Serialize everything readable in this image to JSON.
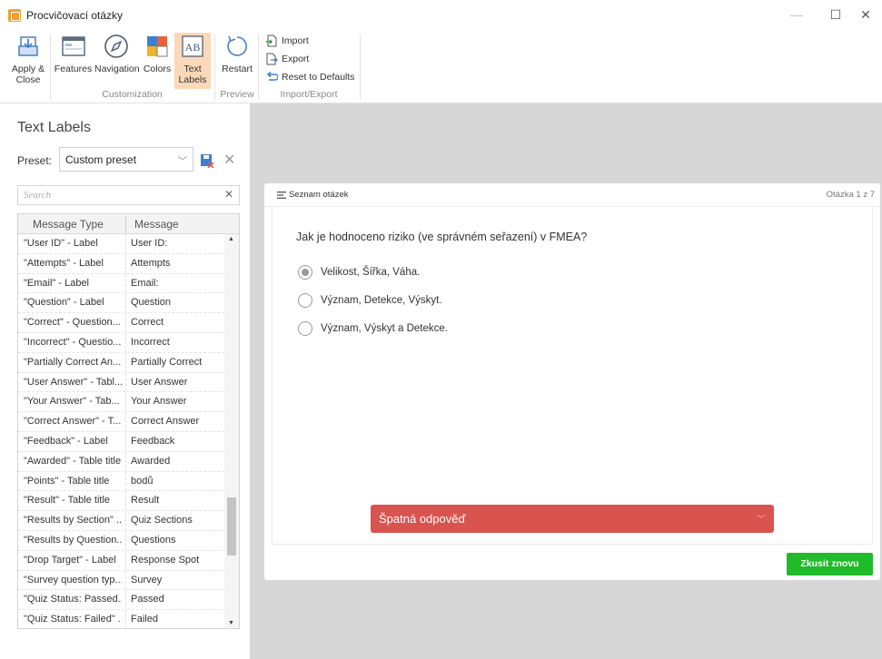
{
  "window": {
    "title": "Procvičovací otázky",
    "min": "—",
    "max": "☐",
    "close": "✕"
  },
  "ribbon": {
    "apply_close": "Apply & Close",
    "features": "Features",
    "navigation": "Navigation",
    "colors": "Colors",
    "text_labels": "Text Labels",
    "restart": "Restart",
    "import": "Import",
    "export": "Export",
    "reset": "Reset to Defaults",
    "groups": {
      "customization": "Customization",
      "preview": "Preview",
      "import_export": "Import/Export"
    }
  },
  "left": {
    "title": "Text Labels",
    "preset_label": "Preset:",
    "preset_value": "Custom preset",
    "search_placeholder": "Search",
    "columns": [
      "Message Type",
      "Message"
    ],
    "rows": [
      [
        "\"User ID\" - Label",
        "User ID:"
      ],
      [
        "\"Attempts\" - Label",
        "Attempts"
      ],
      [
        "\"Email\" - Label",
        "Email:"
      ],
      [
        "\"Question\" - Label",
        "Question"
      ],
      [
        "\"Correct\" - Question...",
        "Correct"
      ],
      [
        "\"Incorrect\" - Questio...",
        "Incorrect"
      ],
      [
        "\"Partially Correct An...",
        "Partially Correct"
      ],
      [
        "\"User Answer\" - Tabl...",
        "User Answer"
      ],
      [
        "\"Your Answer\"  - Tab...",
        "Your Answer"
      ],
      [
        "\"Correct Answer\"  - T...",
        "Correct Answer"
      ],
      [
        "\"Feedback\" - Label",
        "Feedback"
      ],
      [
        "\"Awarded\" - Table title",
        "Awarded"
      ],
      [
        "\"Points\" - Table title",
        "bodů"
      ],
      [
        "\"Result\" - Table title",
        "Result"
      ],
      [
        "\"Results by Section\" ...",
        "Quiz Sections"
      ],
      [
        "\"Results by Question...",
        "Questions"
      ],
      [
        "\"Drop Target\" - Label",
        "Response Spot"
      ],
      [
        "\"Survey question typ...",
        "Survey"
      ],
      [
        "\"Quiz Status: Passed...",
        "Passed"
      ],
      [
        "\"Quiz Status: Failed\" ...",
        "Failed"
      ]
    ]
  },
  "quiz": {
    "list_title": "Seznam otázek",
    "counter": "Otázka 1 z 7",
    "question": "Jak je hodnoceno riziko (ve správném seřazení) v FMEA?",
    "options": [
      {
        "text": "Velikost, Šířka, Váha.",
        "selected": true
      },
      {
        "text": "Význam, Detekce, Výskyt.",
        "selected": false
      },
      {
        "text": "Význam, Výskyt a Detekce.",
        "selected": false
      }
    ],
    "feedback": "Špatná odpověď",
    "retry": "Zkusit znovu"
  },
  "colors": {
    "accent": "#fbd8b8",
    "wrong": "#d9534f",
    "retry": "#1fbb29",
    "preview_bg": "#d7d7d7"
  }
}
